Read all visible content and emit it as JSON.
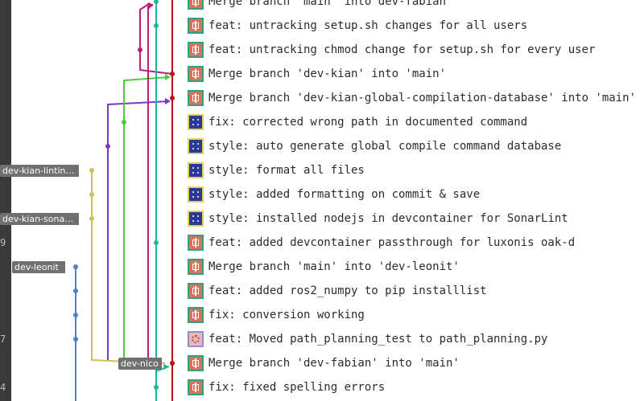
{
  "gutter_numbers": [
    "9",
    "7",
    "4"
  ],
  "branch_tags": [
    {
      "label": "dev-kian-lintin…"
    },
    {
      "label": "dev-kian-sonarl…"
    },
    {
      "label": "dev-leonit"
    },
    {
      "label": "dev-nico"
    }
  ],
  "commits": [
    {
      "message": "Merge branch 'main' into dev-fabian",
      "avatar": "red"
    },
    {
      "message": "feat: untracking setup.sh changes for all users",
      "avatar": "red"
    },
    {
      "message": "feat: untracking chmod change for setup.sh for every user",
      "avatar": "red"
    },
    {
      "message": "Merge branch 'dev-kian' into 'main'",
      "avatar": "red"
    },
    {
      "message": "Merge branch 'dev-kian-global-compilation-database' into 'main'",
      "avatar": "red"
    },
    {
      "message": "fix: corrected wrong path in documented command",
      "avatar": "blue"
    },
    {
      "message": "style: auto generate global compile command database",
      "avatar": "blue"
    },
    {
      "message": "style: format all files",
      "avatar": "blue"
    },
    {
      "message": "style: added formatting on commit & save",
      "avatar": "blue"
    },
    {
      "message": "style: installed nodejs in devcontainer for SonarLint",
      "avatar": "blue"
    },
    {
      "message": "feat: added devcontainer passthrough for luxonis oak-d",
      "avatar": "red"
    },
    {
      "message": "Merge branch 'main' into 'dev-leonit'",
      "avatar": "red"
    },
    {
      "message": "feat: added ros2_numpy to pip installlist",
      "avatar": "red"
    },
    {
      "message": "fix: conversion working",
      "avatar": "red"
    },
    {
      "message": "feat: Moved path_planning_test to path_planning.py",
      "avatar": "pale"
    },
    {
      "message": "Merge branch 'dev-fabian' into 'main'",
      "avatar": "red"
    },
    {
      "message": "fix: fixed spelling errors",
      "avatar": "red"
    }
  ],
  "colors": {
    "main": "#c0101a",
    "dev_fabian": "#c01a7a",
    "teal": "#19b79e",
    "green": "#4ccc3c",
    "purple": "#7a38c4",
    "olive": "#cfc05a",
    "blue": "#4f7fc4"
  }
}
